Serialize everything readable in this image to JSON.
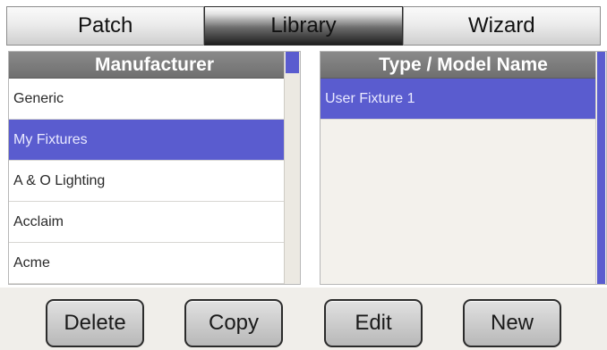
{
  "tabs": [
    {
      "label": "Patch",
      "active": false
    },
    {
      "label": "Library",
      "active": true
    },
    {
      "label": "Wizard",
      "active": false
    }
  ],
  "manufacturer_list": {
    "header": "Manufacturer",
    "items": [
      {
        "label": "Generic",
        "selected": false
      },
      {
        "label": "My Fixtures",
        "selected": true
      },
      {
        "label": "A & O Lighting",
        "selected": false
      },
      {
        "label": "Acclaim",
        "selected": false
      },
      {
        "label": "Acme",
        "selected": false
      }
    ]
  },
  "model_list": {
    "header": "Type / Model Name",
    "items": [
      {
        "label": "User Fixture 1",
        "selected": true
      }
    ]
  },
  "buttons": {
    "delete": "Delete",
    "copy": "Copy",
    "edit": "Edit",
    "new": "New"
  },
  "colors": {
    "selection": "#5a5ccf",
    "header": "#7d7d7d",
    "list_background": "#f3f1ec"
  }
}
